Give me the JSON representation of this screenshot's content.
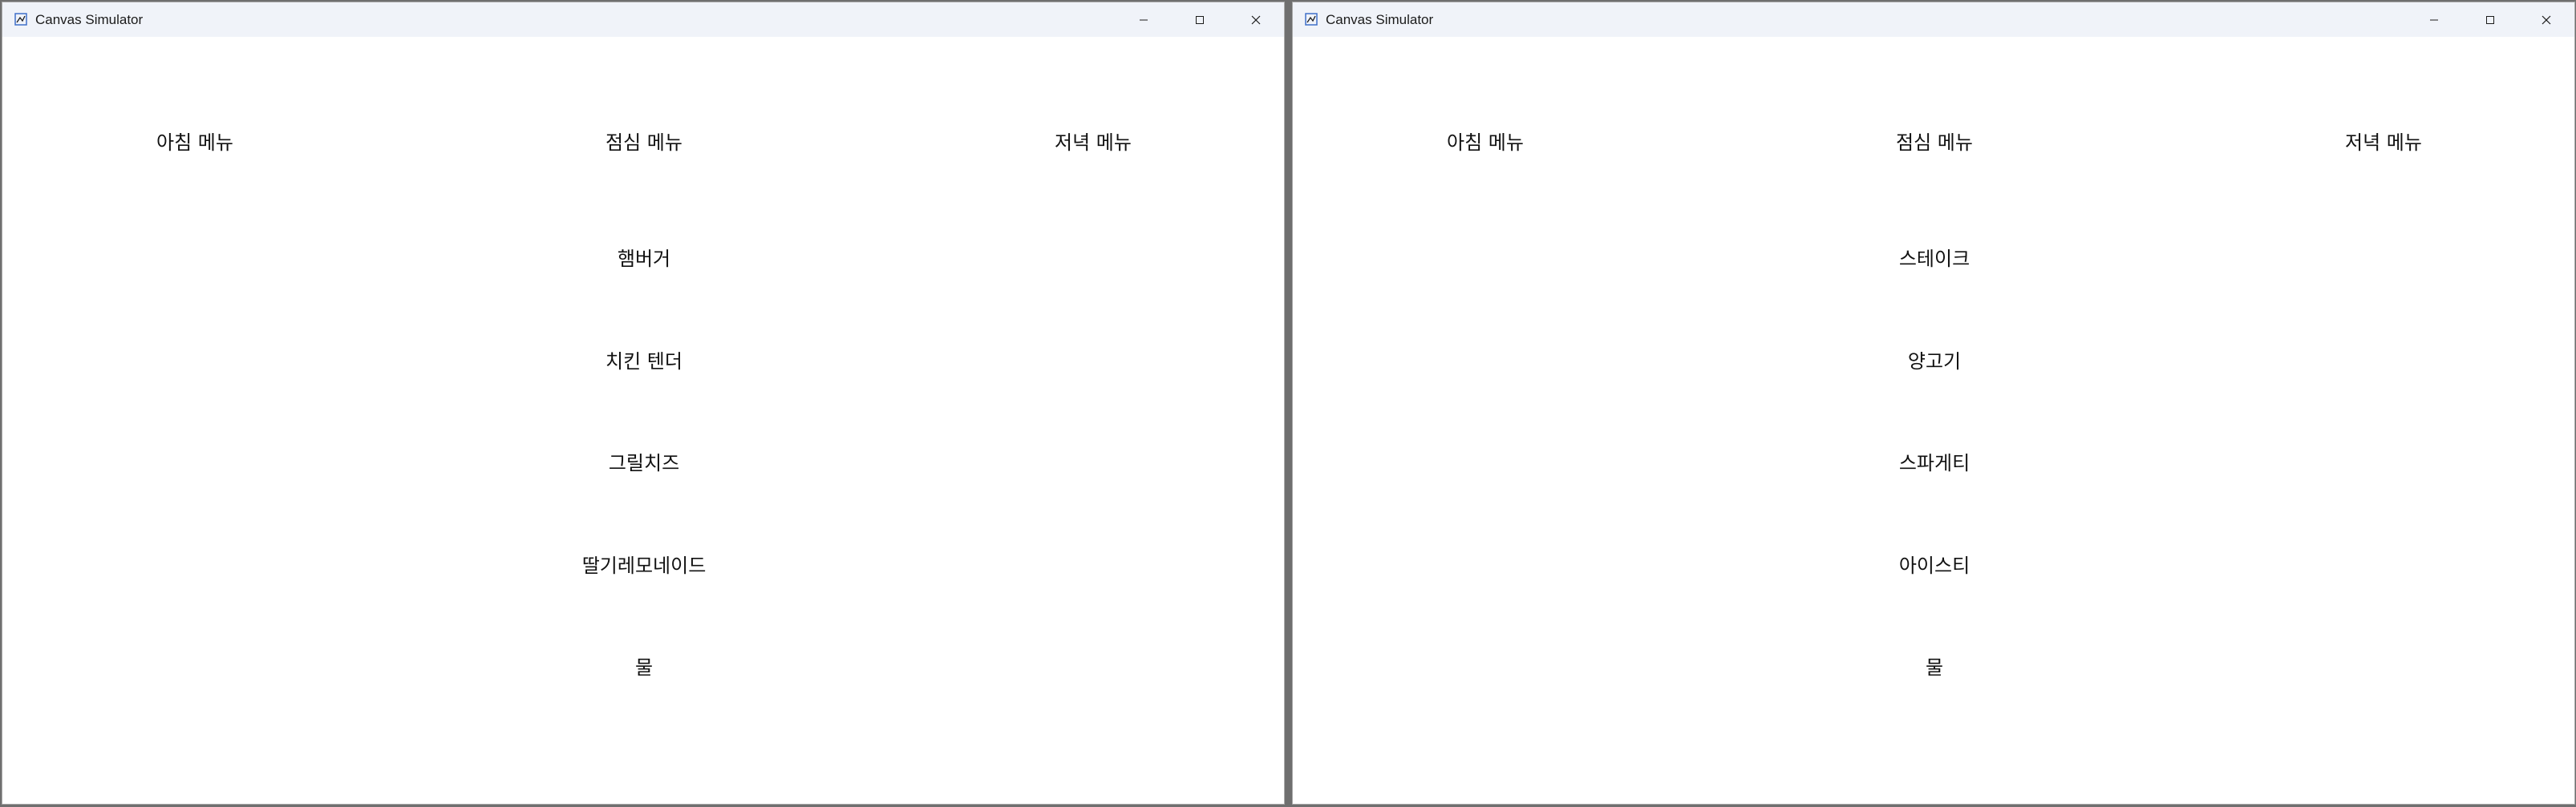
{
  "colors": {
    "titlebar_bg": "#f0f3f9",
    "canvas_bg": "#ffffff",
    "text": "#111111",
    "app_icon_accent": "#3f6fc9"
  },
  "left_window": {
    "title": "Canvas Simulator",
    "icon": "app-window-icon",
    "controls": [
      "minimize-icon",
      "maximize-icon",
      "close-icon"
    ],
    "headers": {
      "breakfast": "아침 메뉴",
      "lunch": "점심 메뉴",
      "dinner": "저녁 메뉴"
    },
    "items": [
      "햄버거",
      "치킨 텐더",
      "그릴치즈",
      "딸기레모네이드",
      "물"
    ]
  },
  "right_window": {
    "title": "Canvas Simulator",
    "icon": "app-window-icon",
    "controls": [
      "minimize-icon",
      "maximize-icon",
      "close-icon"
    ],
    "headers": {
      "breakfast": "아침 메뉴",
      "lunch": "점심 메뉴",
      "dinner": "저녁 메뉴"
    },
    "items": [
      "스테이크",
      "양고기",
      "스파게티",
      "아이스티",
      "물"
    ]
  }
}
